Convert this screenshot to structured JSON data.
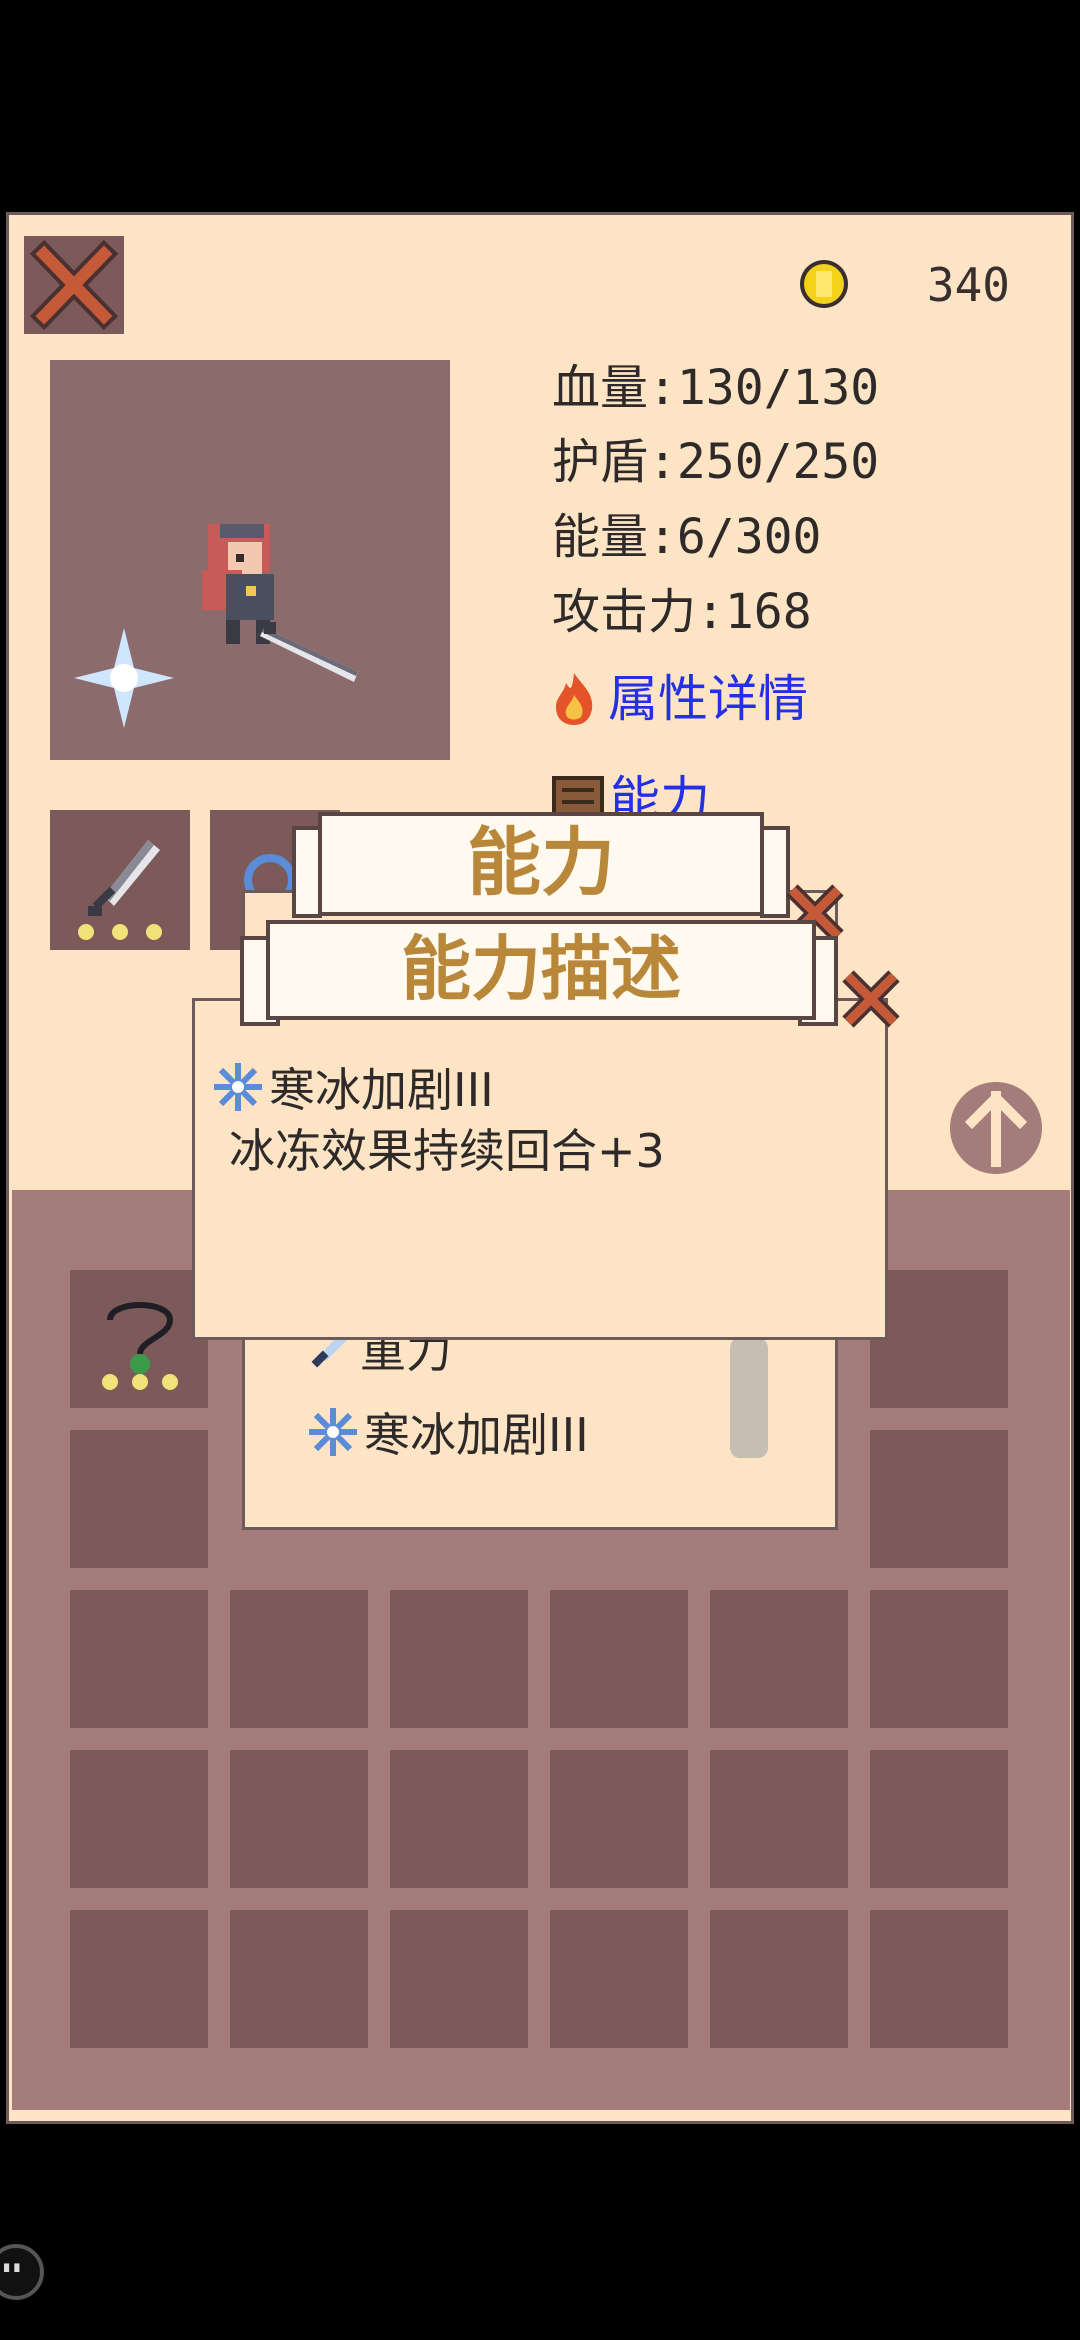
{
  "header": {
    "coins": "340",
    "icons": [
      "close-icon",
      "coin-icon"
    ]
  },
  "stats": {
    "hp": "血量:130/130",
    "shield": "护盾:250/250",
    "energy": "能量:6/300",
    "attack": "攻击力:168",
    "attr_link": "属性详情",
    "ability_link": "能力"
  },
  "ability_popup": {
    "title": "能力",
    "items": [
      {
        "label": "重力",
        "icon": "sword-icon"
      },
      {
        "label": "寒冰加剧III",
        "icon": "snowflake-icon"
      }
    ]
  },
  "desc_popup": {
    "title": "能力描述",
    "ability_name": "寒冰加剧III",
    "description": "冰冻效果持续回合+3"
  },
  "colors": {
    "panel": "#fde4c4",
    "slot": "#7c5a5a",
    "link": "#2430e8",
    "banner_text": "#b8873a"
  }
}
